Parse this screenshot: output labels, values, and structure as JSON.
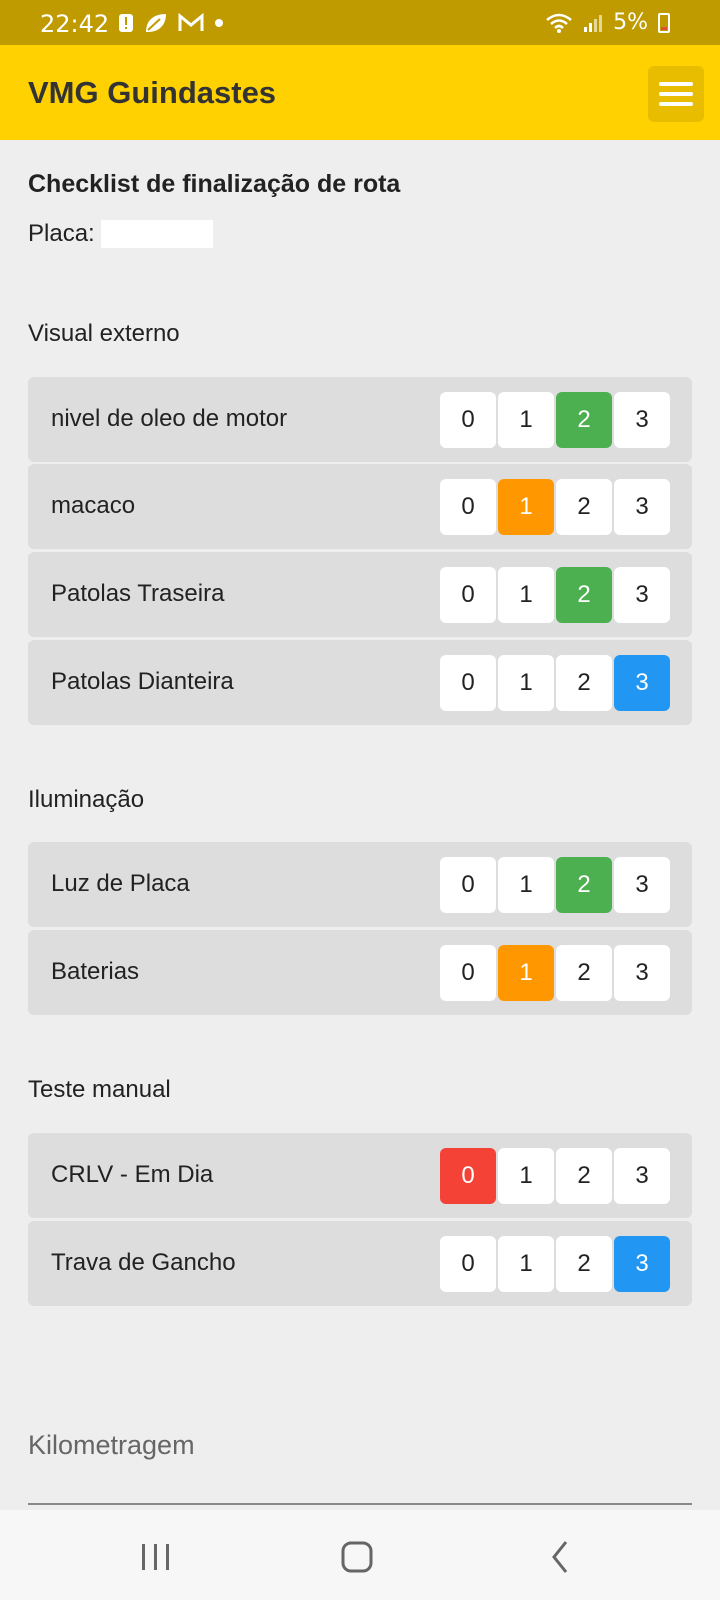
{
  "status_bar": {
    "time": "22:42",
    "battery": "5%",
    "icons_left": [
      "alert-icon",
      "leaf-icon",
      "gmail-icon",
      "dot-icon"
    ],
    "icons_right": [
      "wifi-icon",
      "signal-icon",
      "battery-icon"
    ]
  },
  "app_bar": {
    "title": "VMG Guindastes",
    "menu_icon": "hamburger-menu-icon"
  },
  "page": {
    "title": "Checklist de finalização de rota",
    "placa_label": "Placa:",
    "placa_value": ""
  },
  "options": [
    "0",
    "1",
    "2",
    "3"
  ],
  "colors": {
    "status_bar": "#bf9b00",
    "app_bar": "#ffd100",
    "selected_0": "#f44336",
    "selected_1": "#ff9800",
    "selected_2": "#4caf50",
    "selected_3": "#2196f3"
  },
  "sections": [
    {
      "title": "Visual externo",
      "items": [
        {
          "label": "nivel de oleo de motor",
          "selected": 2
        },
        {
          "label": "macaco",
          "selected": 1
        },
        {
          "label": "Patolas Traseira",
          "selected": 2
        },
        {
          "label": "Patolas Dianteira",
          "selected": 3
        }
      ]
    },
    {
      "title": "Iluminação",
      "items": [
        {
          "label": "Luz de Placa",
          "selected": 2
        },
        {
          "label": "Baterias",
          "selected": 1
        }
      ]
    },
    {
      "title": "Teste manual",
      "items": [
        {
          "label": "CRLV - Em Dia",
          "selected": 0
        },
        {
          "label": "Trava de Gancho",
          "selected": 3
        }
      ]
    }
  ],
  "kilometragem": {
    "placeholder": "Kilometragem"
  },
  "nav_bar": {
    "buttons": [
      "recent-apps-icon",
      "home-icon",
      "back-icon"
    ]
  }
}
